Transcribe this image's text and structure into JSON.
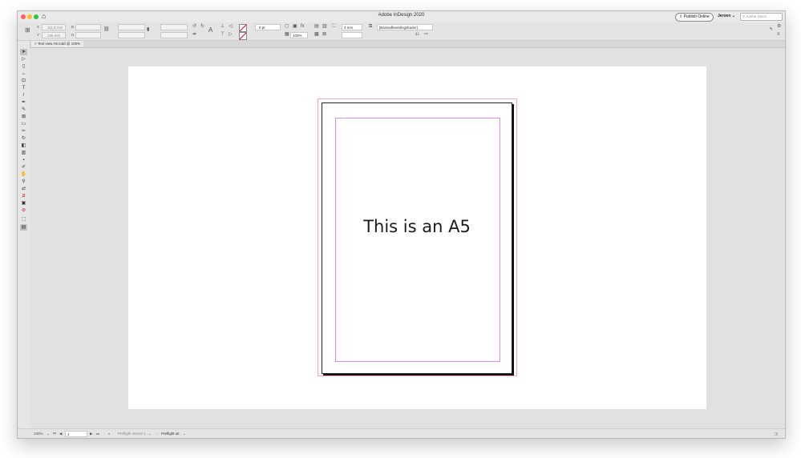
{
  "window": {
    "title": "Adobe InDesign 2020"
  },
  "header": {
    "publish_label": "Publish Online",
    "user_label": "Jeroen",
    "search_placeholder": "Adobe Stock"
  },
  "control": {
    "x_label": "X",
    "x_value": "111,5 mm",
    "y_label": "Y",
    "y_value": "105 mm",
    "w_label": "B",
    "h_label": "H",
    "stroke_weight": "0 pt",
    "opacity": "100%",
    "spacing": "4 mm",
    "object_style": "[Basisafbeeldingskader]"
  },
  "document_tab": {
    "label": "Test view A5.indd @ 100%",
    "close": "×"
  },
  "page": {
    "text": "This is an A5"
  },
  "status": {
    "zoom": "100%",
    "page_number": "1",
    "preflight_profile": "Preflight Jeroen (...",
    "preflight_status": "Preflight uit"
  },
  "colors": {
    "margin_guide": "#d88be8",
    "bleed_guide": "#f2a7b7",
    "pasteboard": "#e1e1e1"
  }
}
